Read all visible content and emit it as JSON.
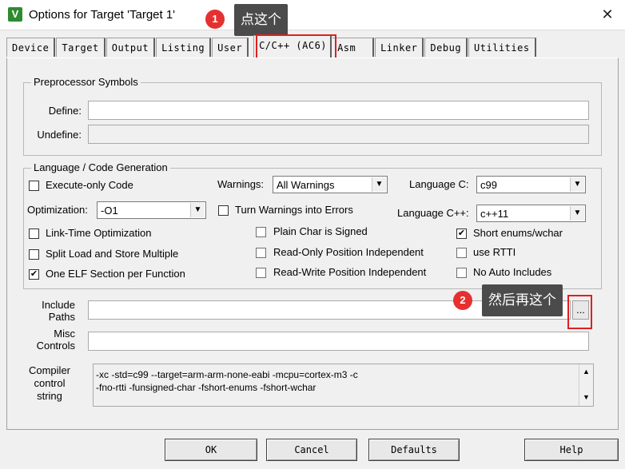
{
  "window": {
    "title": "Options for Target 'Target 1'",
    "close_glyph": "✕",
    "icon": "keil-icon"
  },
  "annotations": [
    {
      "number": "1",
      "text": "点这个"
    },
    {
      "number": "2",
      "text": "然后再这个"
    }
  ],
  "tabs": [
    "Device",
    "Target",
    "Output",
    "Listing",
    "User",
    "C/C++ (AC6)",
    "Asm",
    "Linker",
    "Debug",
    "Utilities"
  ],
  "active_tab": "C/C++ (AC6)",
  "preprocessor": {
    "group_label": "Preprocessor Symbols",
    "define_label": "Define:",
    "define_value": "",
    "undefine_label": "Undefine:",
    "undefine_value": ""
  },
  "language": {
    "group_label": "Language / Code Generation",
    "execute_only": {
      "label": "Execute-only Code",
      "checked": false
    },
    "warnings": {
      "label": "Warnings:",
      "value": "All Warnings"
    },
    "language_c": {
      "label": "Language C:",
      "value": "c99"
    },
    "optimization": {
      "label": "Optimization:",
      "value": "-O1"
    },
    "turn_warnings": {
      "label": "Turn Warnings into Errors",
      "checked": false
    },
    "language_cpp": {
      "label": "Language C++:",
      "value": "c++11"
    },
    "lto": {
      "label": "Link-Time Optimization",
      "checked": false
    },
    "plain_char": {
      "label": "Plain Char is Signed",
      "checked": false
    },
    "short_enums": {
      "label": "Short enums/wchar",
      "checked": true
    },
    "split_load": {
      "label": "Split Load and Store Multiple",
      "checked": false
    },
    "ropi": {
      "label": "Read-Only Position Independent",
      "checked": false
    },
    "rtti": {
      "label": "use RTTI",
      "checked": false
    },
    "one_elf": {
      "label": "One ELF Section per Function",
      "checked": true
    },
    "rwpi": {
      "label": "Read-Write Position Independent",
      "checked": false
    },
    "no_auto": {
      "label": "No Auto Includes",
      "checked": false
    }
  },
  "include_paths": {
    "label_line1": "Include",
    "label_line2": "Paths",
    "value": "",
    "browse_label": "..."
  },
  "misc_controls": {
    "label_line1": "Misc",
    "label_line2": "Controls",
    "value": ""
  },
  "compiler_control": {
    "label_line1": "Compiler",
    "label_line2": "control",
    "label_line3": "string",
    "line1": "-xc -std=c99 --target=arm-arm-none-eabi -mcpu=cortex-m3 -c",
    "line2": "-fno-rtti -funsigned-char -fshort-enums -fshort-wchar"
  },
  "buttons": {
    "ok": "OK",
    "cancel": "Cancel",
    "defaults": "Defaults",
    "help": "Help"
  },
  "colors": {
    "highlight": "#e02020",
    "badge": "#e63030",
    "callout": "#4b4b4b"
  }
}
